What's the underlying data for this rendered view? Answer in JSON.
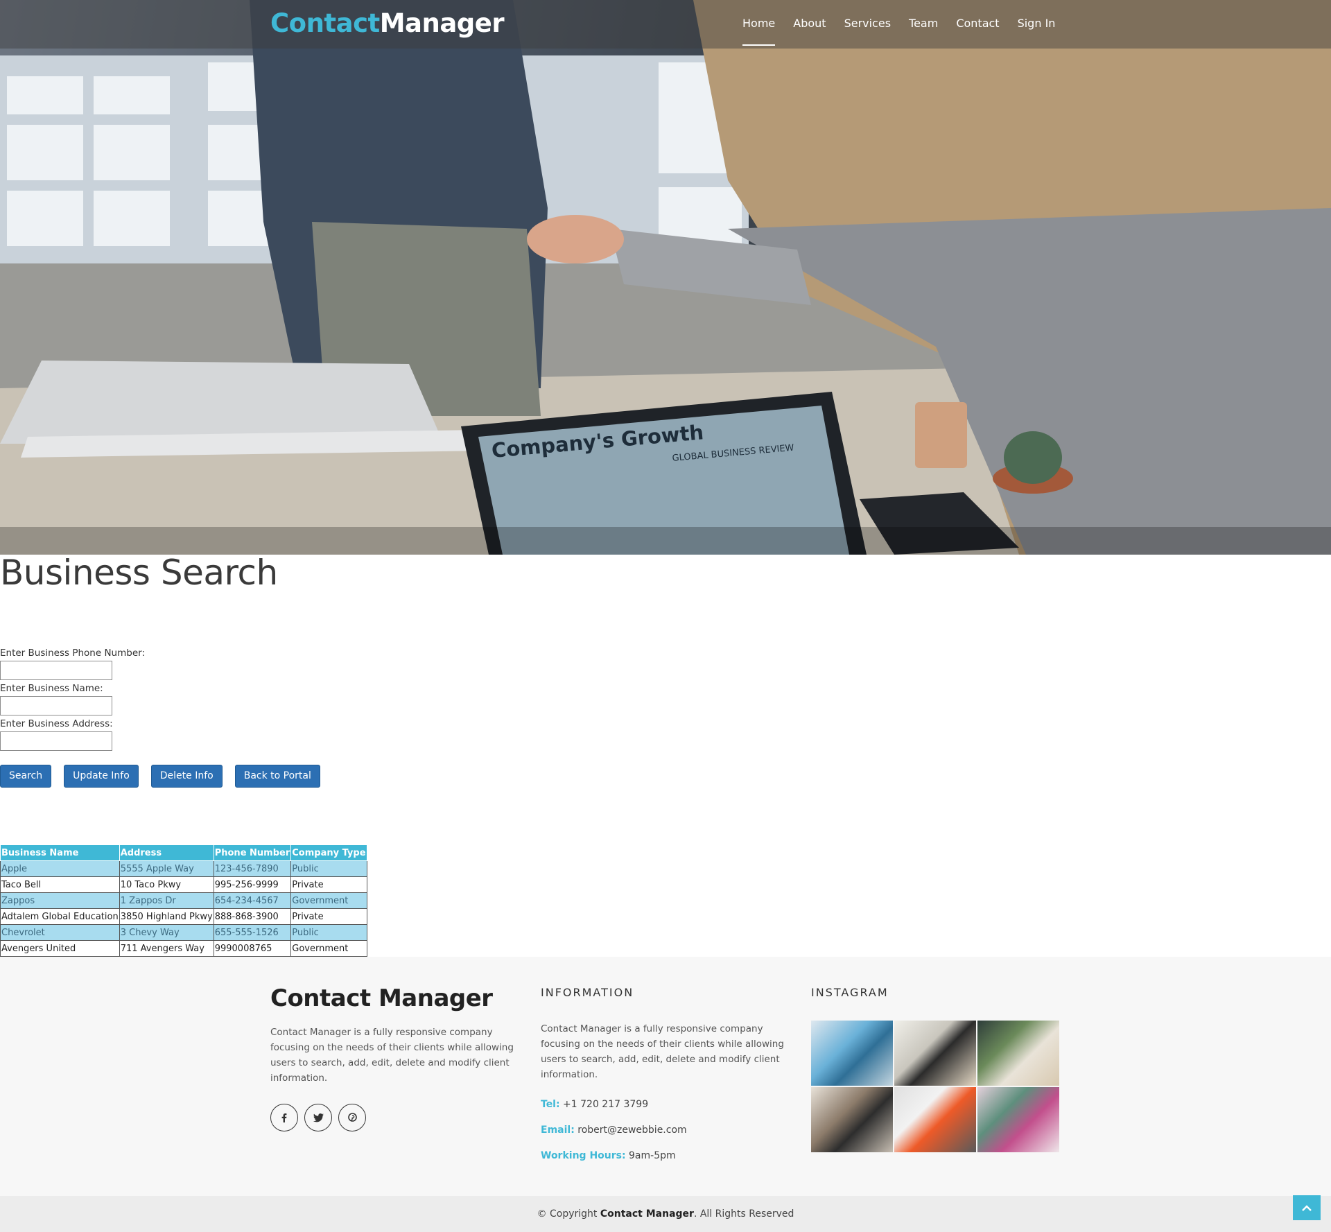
{
  "header": {
    "brand_part1": "Contact",
    "brand_part2": "Manager",
    "nav": [
      "Home",
      "About",
      "Services",
      "Team",
      "Contact",
      "Sign In"
    ],
    "active_nav": "Home"
  },
  "hero": {
    "laptop_text": "Company's Growth",
    "laptop_subtext": "GLOBAL BUSINESS REVIEW"
  },
  "main": {
    "title": "Business Search",
    "form": {
      "phone_label": "Enter Business Phone Number:",
      "phone_value": "",
      "name_label": "Enter Business Name:",
      "name_value": "",
      "address_label": "Enter Business Address:",
      "address_value": ""
    },
    "buttons": {
      "search": "Search",
      "update": "Update Info",
      "delete": "Delete Info",
      "back": "Back to Portal"
    },
    "table": {
      "headers": [
        "Business Name",
        "Address",
        "Phone Number",
        "Company Type"
      ],
      "rows": [
        [
          "Apple",
          "5555 Apple Way",
          "123-456-7890",
          "Public"
        ],
        [
          "Taco Bell",
          "10 Taco Pkwy",
          "995-256-9999",
          "Private"
        ],
        [
          "Zappos",
          "1 Zappos Dr",
          "654-234-4567",
          "Government"
        ],
        [
          "Adtalem Global Education",
          "3850 Highland Pkwy",
          "888-868-3900",
          "Private"
        ],
        [
          "Chevrolet",
          "3 Chevy Way",
          "655-555-1526",
          "Public"
        ],
        [
          "Avengers United",
          "711 Avengers Way",
          "9990008765",
          "Government"
        ]
      ]
    }
  },
  "footer": {
    "brand": "Contact Manager",
    "description": "Contact Manager is a fully responsive company focusing on the needs of their clients while allowing users to search, add, edit, delete and modify client information.",
    "info_heading": "INFORMATION",
    "info_description": "Contact Manager is a fully responsive company focusing on the needs of their clients while allowing users to search, add, edit, delete and modify client information.",
    "tel_label": "Tel:",
    "tel_value": " +1 720 217 3799",
    "email_label": "Email:",
    "email_value": " robert@zewebbie.com",
    "hours_label": "Working Hours:",
    "hours_value": " 9am-5pm",
    "instagram_heading": "INSTAGRAM",
    "social_icons": [
      "facebook-icon",
      "twitter-icon",
      "pinterest-icon"
    ],
    "copyright_prefix": "© Copyright ",
    "copyright_brand": "Contact Manager",
    "copyright_suffix": ". All Rights Reserved"
  },
  "colors": {
    "accent": "#3fb8d6",
    "button": "#2c6fb3",
    "table_header": "#3fb8d6",
    "table_row_alt": "#a8dcef"
  }
}
